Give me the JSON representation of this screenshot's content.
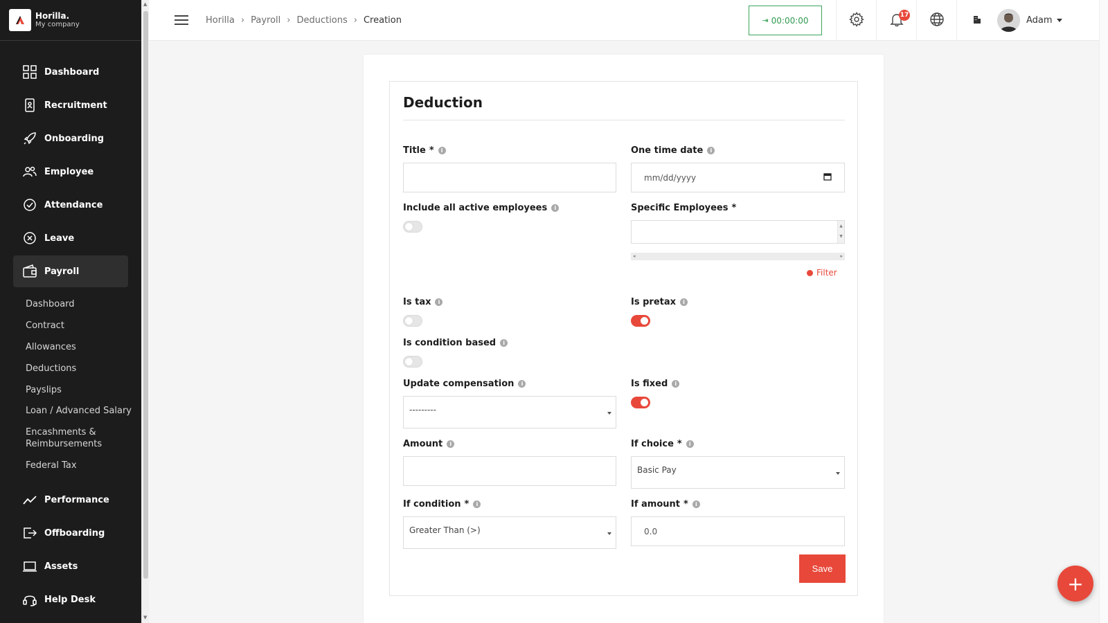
{
  "brand": {
    "name": "Horilla.",
    "company": "My company"
  },
  "sidebar": {
    "items": [
      {
        "label": "Dashboard",
        "icon": "dashboard-icon"
      },
      {
        "label": "Recruitment",
        "icon": "recruitment-icon"
      },
      {
        "label": "Onboarding",
        "icon": "rocket-icon"
      },
      {
        "label": "Employee",
        "icon": "people-icon"
      },
      {
        "label": "Attendance",
        "icon": "check-circle-icon"
      },
      {
        "label": "Leave",
        "icon": "x-circle-icon"
      },
      {
        "label": "Payroll",
        "icon": "wallet-icon"
      }
    ],
    "payroll_sub": [
      "Dashboard",
      "Contract",
      "Allowances",
      "Deductions",
      "Payslips",
      "Loan / Advanced Salary",
      "Encashments & Reimbursements",
      "Federal Tax"
    ],
    "items2": [
      {
        "label": "Performance",
        "icon": "trend-icon"
      },
      {
        "label": "Offboarding",
        "icon": "exit-icon"
      },
      {
        "label": "Assets",
        "icon": "laptop-icon"
      },
      {
        "label": "Help Desk",
        "icon": "headset-icon"
      }
    ]
  },
  "header": {
    "breadcrumb": [
      "Horilla",
      "Payroll",
      "Deductions",
      "Creation"
    ],
    "timer": "00:00:00",
    "notification_count": "17",
    "user_name": "Adam"
  },
  "form": {
    "title": "Deduction",
    "fields": {
      "title": {
        "label": "Title",
        "required": "*",
        "value": ""
      },
      "one_time_date": {
        "label": "One time date",
        "placeholder": "mm/dd/yyyy"
      },
      "include_all": {
        "label": "Include all active employees",
        "on": false
      },
      "specific_employees": {
        "label": "Specific Employees",
        "required": "*"
      },
      "filter": "Filter",
      "is_tax": {
        "label": "Is tax",
        "on": false
      },
      "is_pretax": {
        "label": "Is pretax",
        "on": true
      },
      "is_condition_based": {
        "label": "Is condition based",
        "on": false
      },
      "update_compensation": {
        "label": "Update compensation",
        "value": "---------"
      },
      "is_fixed": {
        "label": "Is fixed",
        "on": true
      },
      "amount": {
        "label": "Amount",
        "value": ""
      },
      "if_choice": {
        "label": "If choice",
        "required": "*",
        "value": "Basic Pay"
      },
      "if_condition": {
        "label": "If condition",
        "required": "*",
        "value": "Greater Than (>)"
      },
      "if_amount": {
        "label": "If amount",
        "required": "*",
        "value": "0.0"
      }
    },
    "save_label": "Save"
  },
  "fab_label": "+",
  "colors": {
    "accent": "#e8483a",
    "sidebar_bg": "#1c1c1c",
    "timer_green": "#2f9a4f"
  }
}
